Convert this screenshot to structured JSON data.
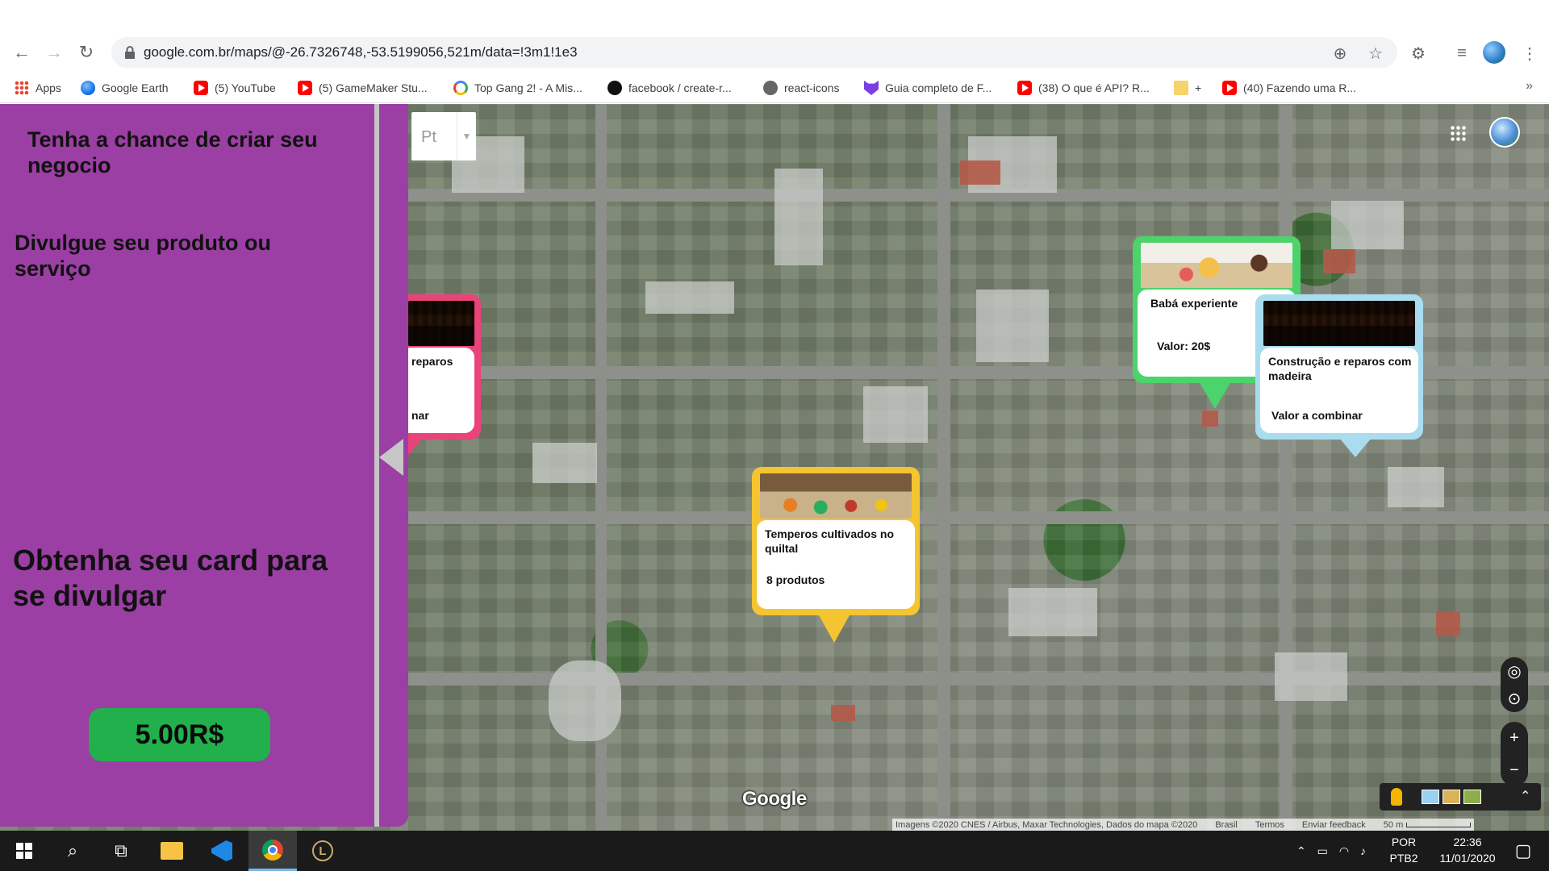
{
  "browser": {
    "url": "google.com.br/maps/@-26.7326748,-53.5199056,521m/data=!3m1!1e3",
    "bookmarks": [
      {
        "label": "Apps",
        "icon": "apps-icon"
      },
      {
        "label": "Google Earth",
        "icon": "google-earth-icon"
      },
      {
        "label": "(5) YouTube",
        "icon": "youtube-icon"
      },
      {
        "label": "(5) GameMaker Stu...",
        "icon": "youtube-icon"
      },
      {
        "label": "Top Gang 2! - A Mis...",
        "icon": "google-icon"
      },
      {
        "label": "facebook / create-r...",
        "icon": "github-icon"
      },
      {
        "label": "react-icons",
        "icon": "react-icons-icon"
      },
      {
        "label": "Guia completo de F...",
        "icon": "guia-icon"
      },
      {
        "label": "(38) O que é API? R...",
        "icon": "youtube-icon"
      },
      {
        "label": "+",
        "icon": "folder-icon"
      },
      {
        "label": "(40) Fazendo uma R...",
        "icon": "youtube-icon"
      }
    ],
    "more_bookmarks": "»"
  },
  "panel": {
    "heading1": "Tenha a chance de criar seu negocio",
    "heading2": "Divulgue seu produto ou serviço",
    "heading3": "Obtenha seu card para se divulgar",
    "price": "5.00R$",
    "colors": {
      "background": "#9b3fa4",
      "price_button": "#21b04b"
    }
  },
  "map": {
    "type_label": "Pt",
    "logo": "Google",
    "attribution": "Imagens ©2020 CNES / Airbus, Maxar Technologies, Dados do mapa ©2020",
    "country": "Brasil",
    "terms": "Termos",
    "feedback": "Enviar feedback",
    "scale": "50 m"
  },
  "cards": [
    {
      "title": "reparos",
      "value": "nar",
      "border_color": "#e9437a",
      "image": "woodworking-image"
    },
    {
      "title": "Babá experiente",
      "value": "Valor: 20$",
      "border_color": "#4cd36b",
      "image": "children-playing-image"
    },
    {
      "title": "Construção e reparos com madeira",
      "value": "Valor a combinar",
      "border_color": "#a9dcee",
      "image": "woodworking-image"
    },
    {
      "title": "Temperos cultivados no quiltal",
      "value": "8 produtos",
      "border_color": "#f5c431",
      "image": "vegetables-image"
    }
  ],
  "taskbar": {
    "language": "POR",
    "layout": "PTB2",
    "time": "22:36",
    "date": "11/01/2020"
  }
}
